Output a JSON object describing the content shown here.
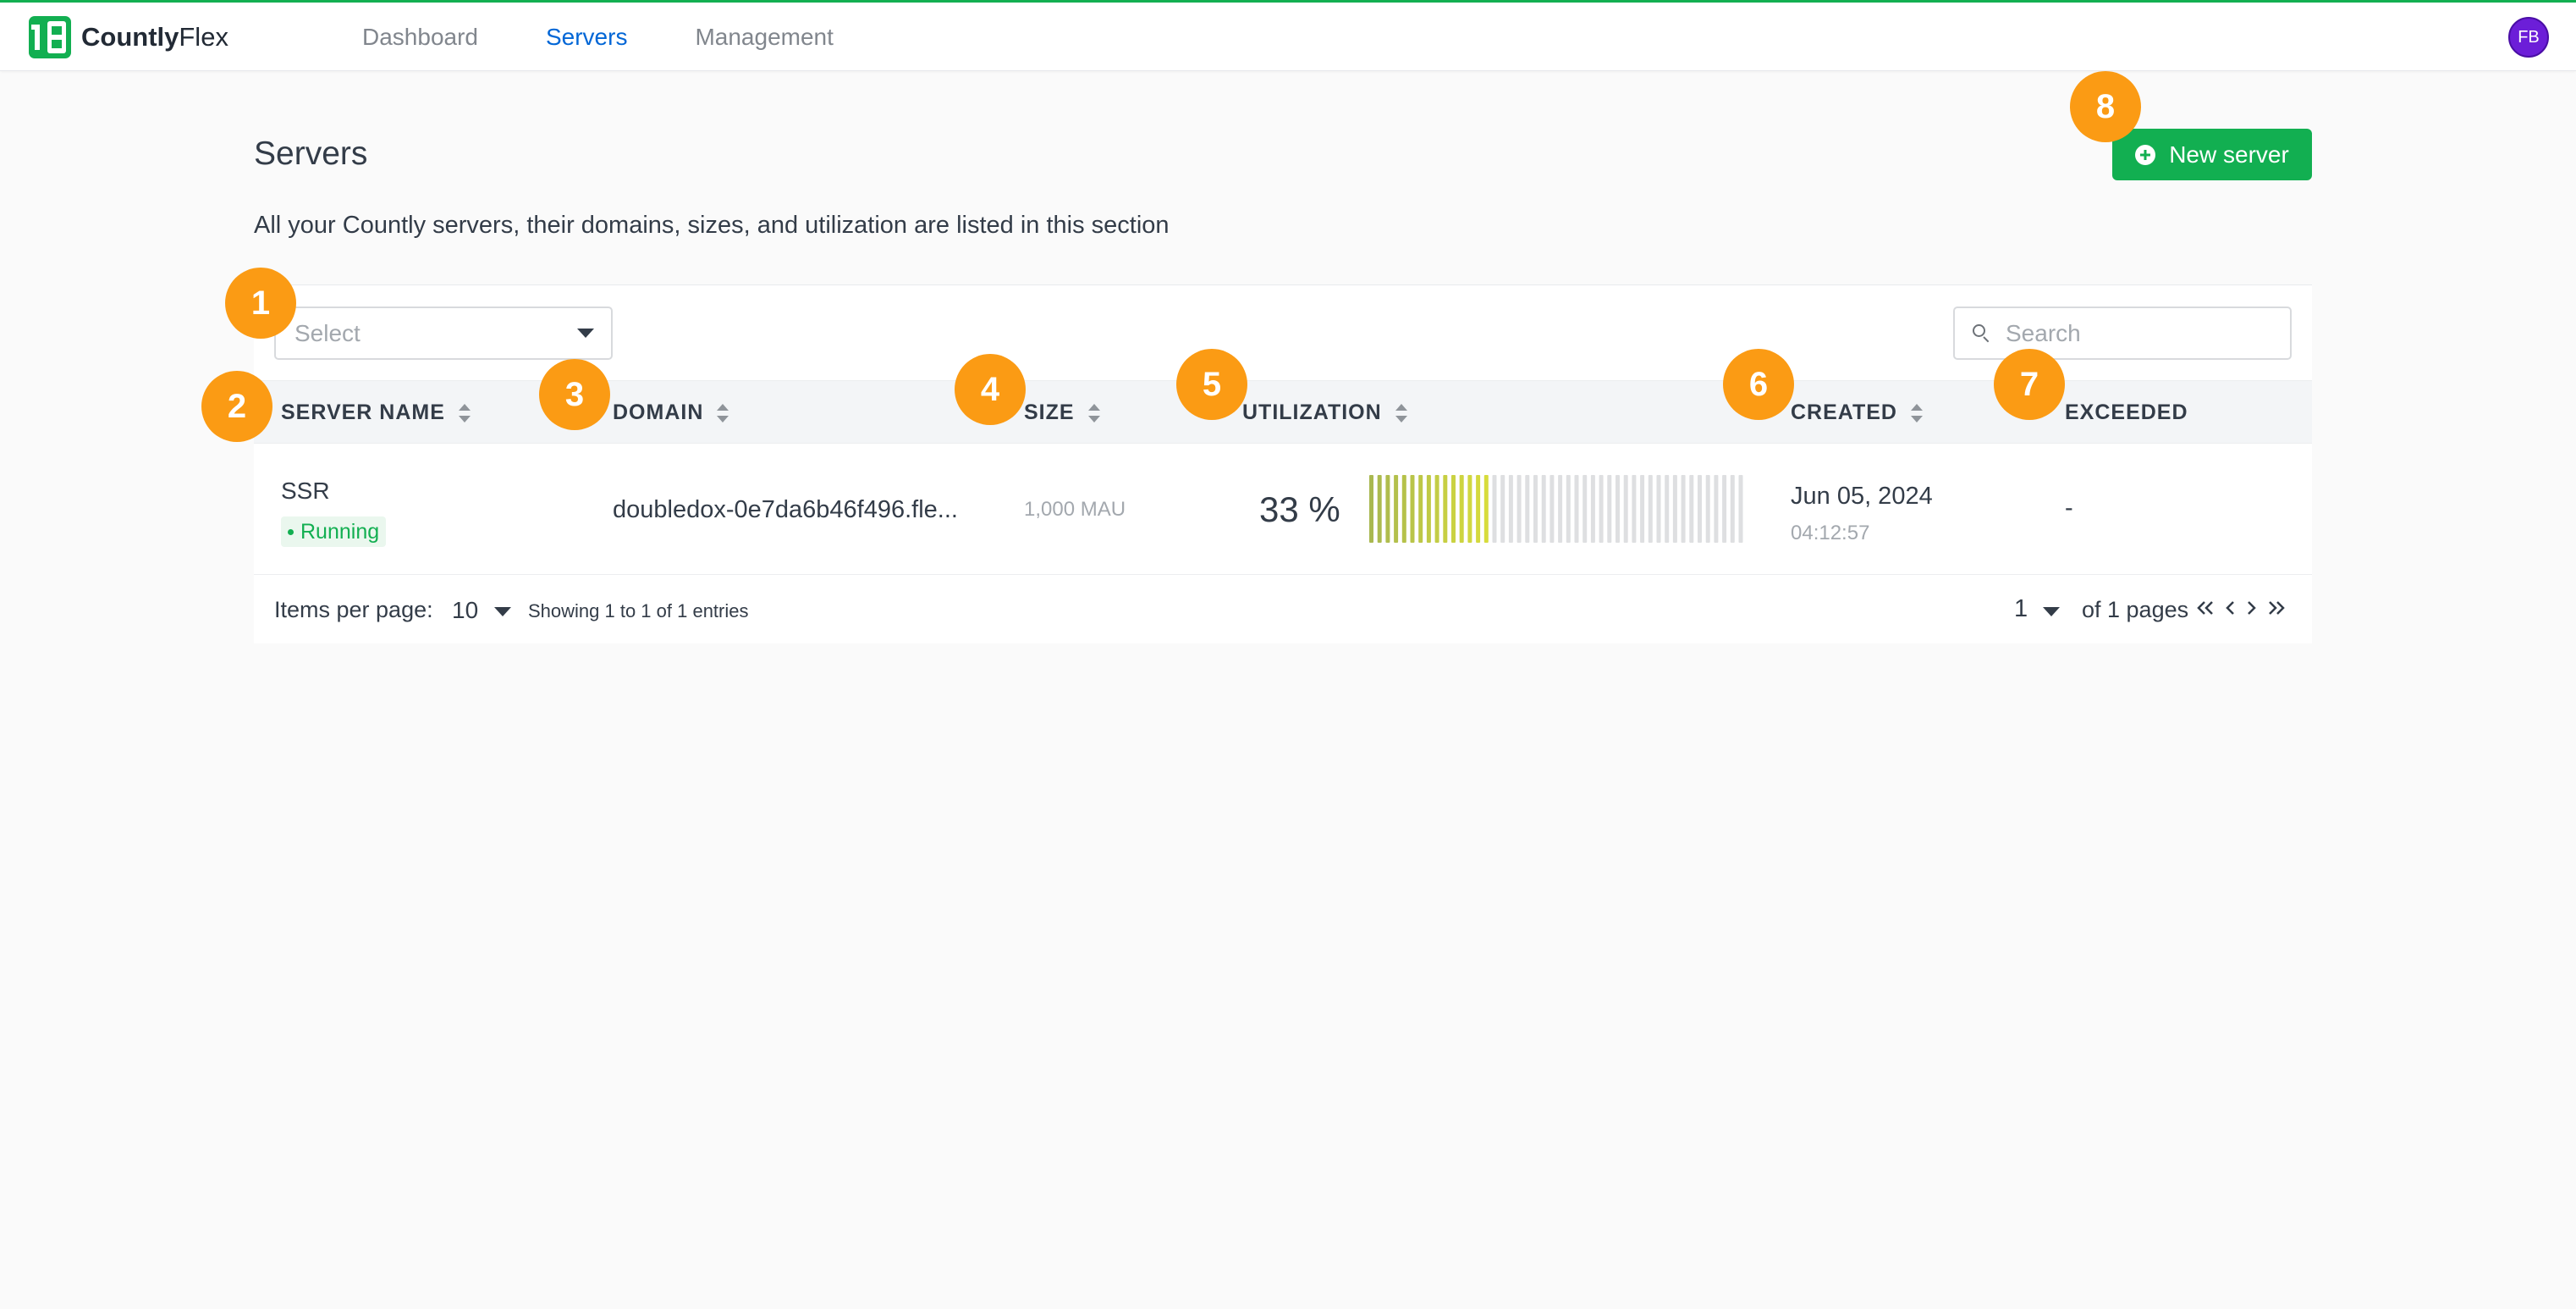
{
  "app": {
    "logo_bold": "Countly",
    "logo_light": "Flex",
    "brand_color": "#12af51",
    "avatar_initials": "FB",
    "avatar_color": "#6c1ed8"
  },
  "nav": {
    "items": [
      {
        "label": "Dashboard",
        "active": false
      },
      {
        "label": "Servers",
        "active": true
      },
      {
        "label": "Management",
        "active": false
      }
    ]
  },
  "page": {
    "title": "Servers",
    "description": "All your Countly servers, their domains, sizes, and utilization are listed in this section",
    "new_button_label": "New server"
  },
  "filters": {
    "select_placeholder": "Select",
    "search_placeholder": "Search"
  },
  "table": {
    "columns": [
      {
        "label": "SERVER NAME",
        "sortable": true
      },
      {
        "label": "DOMAIN",
        "sortable": true
      },
      {
        "label": "SIZE",
        "sortable": true
      },
      {
        "label": "UTILIZATION",
        "sortable": true
      },
      {
        "label": "CREATED",
        "sortable": true
      },
      {
        "label": "EXCEEDED",
        "sortable": false
      }
    ],
    "rows": [
      {
        "server_name": "SSR",
        "status": "Running",
        "domain": "doubledox-0e7da6b46f496.fle...",
        "size": "1,000 MAU",
        "utilization_text": "33 %",
        "utilization": 0.33,
        "created_date": "Jun 05, 2024",
        "created_time": "04:12:57",
        "exceeded": "-"
      }
    ]
  },
  "pagination": {
    "items_per_page_label": "Items per page:",
    "items_per_page_value": "10",
    "showing_text": "Showing 1 to 1 of 1 entries",
    "current_page": "1",
    "of_pages_text": "of 1 pages"
  },
  "annotations": [
    "1",
    "2",
    "3",
    "4",
    "5",
    "6",
    "7",
    "8"
  ],
  "colors": {
    "annotation_marker": "#fb9b14",
    "util_filled_start": "#a9b850",
    "util_filled_end": "#d7dc3c",
    "util_empty": "#dedfe1",
    "link_active": "#0166d6"
  }
}
